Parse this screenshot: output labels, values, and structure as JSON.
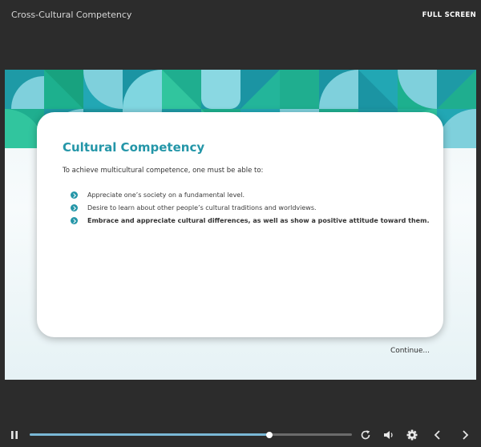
{
  "header": {
    "course_title": "Cross-Cultural Competency",
    "fullscreen_label": "FULL SCREEN"
  },
  "slide": {
    "title": "Cultural Competency",
    "intro": "To achieve multicultural competence, one must be able to:",
    "bullets": [
      "Appreciate one’s society on a fundamental level.",
      "Desire to learn about other people’s cultural traditions and worldviews.",
      "Embrace and appreciate cultural differences, as well as show a positive attitude toward them."
    ],
    "continue_label": "Continue..."
  },
  "player": {
    "progress": 0.744,
    "controls": [
      "pause-icon",
      "replay-icon",
      "volume-icon",
      "settings-icon",
      "previous-icon",
      "next-icon"
    ]
  },
  "colors": {
    "accent": "#2496a8",
    "pattern_teal": "#1b9aa8",
    "pattern_green": "#1eb38c",
    "pattern_light": "#7fd0dc"
  }
}
